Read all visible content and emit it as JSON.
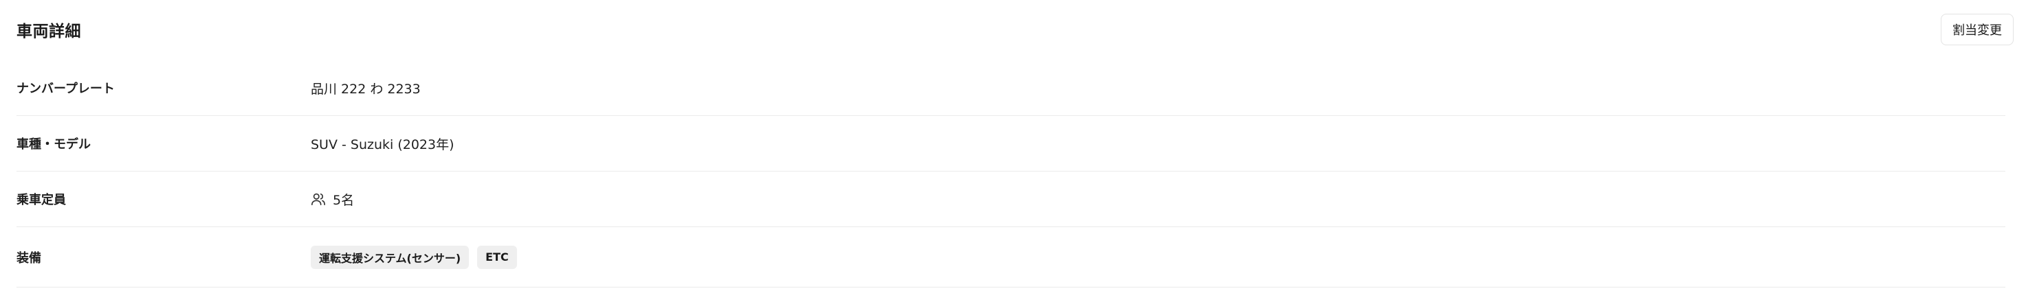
{
  "header": {
    "title": "車両詳細",
    "reassign_button": "割当変更"
  },
  "details": [
    {
      "label": "ナンバープレート",
      "value": "品川 222 わ 2233"
    },
    {
      "label": "車種・モデル",
      "value": "SUV - Suzuki (2023年)"
    },
    {
      "label": "乗車定員",
      "value": "5名",
      "icon": "people-icon"
    },
    {
      "label": "装備",
      "tags": [
        "運転支援システム(センサー)",
        "ETC"
      ]
    }
  ]
}
